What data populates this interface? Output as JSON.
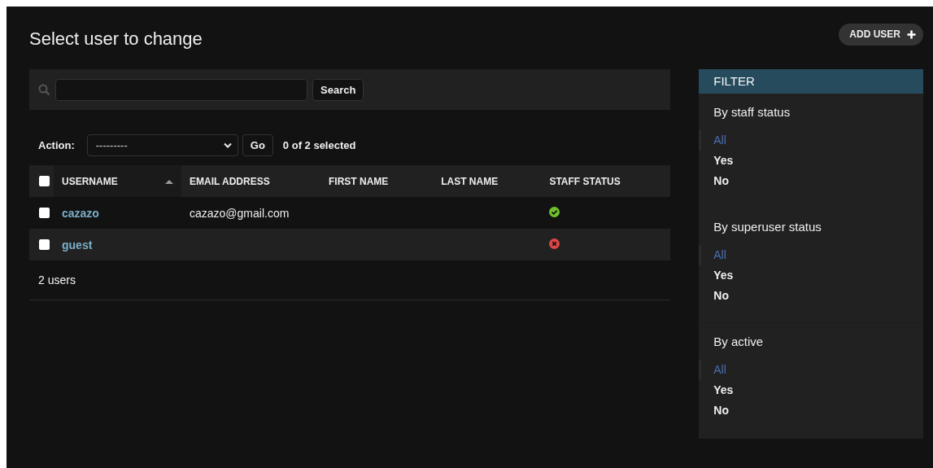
{
  "title": "Select user to change",
  "add_button": {
    "label": "ADD USER"
  },
  "search": {
    "button": "Search"
  },
  "actions": {
    "label": "Action:",
    "value": "---------",
    "go": "Go",
    "counter": "0 of 2 selected"
  },
  "table": {
    "select_all": {
      "checked": false
    },
    "columns": [
      {
        "label": "USERNAME",
        "sorted": true
      },
      {
        "label": "EMAIL ADDRESS",
        "sorted": false
      },
      {
        "label": "FIRST NAME",
        "sorted": false
      },
      {
        "label": "LAST NAME",
        "sorted": false
      },
      {
        "label": "STAFF STATUS",
        "sorted": false
      }
    ],
    "rows": [
      {
        "checked": false,
        "username": "cazazo",
        "email": "cazazo@gmail.com",
        "staff": true
      },
      {
        "checked": false,
        "username": "guest",
        "staff": false
      }
    ]
  },
  "paginator": "2 users",
  "filter": {
    "title": "FILTER",
    "groups": [
      {
        "title": "By staff status",
        "options": [
          {
            "label": "All",
            "selected": true
          },
          {
            "label": "Yes",
            "selected": false
          },
          {
            "label": "No",
            "selected": false
          }
        ]
      },
      {
        "title": "By superuser status",
        "options": [
          {
            "label": "All",
            "selected": true
          },
          {
            "label": "Yes",
            "selected": false
          },
          {
            "label": "No",
            "selected": false
          }
        ]
      },
      {
        "title": "By active",
        "options": [
          {
            "label": "All",
            "selected": true
          },
          {
            "label": "Yes",
            "selected": false
          },
          {
            "label": "No",
            "selected": false
          }
        ]
      }
    ]
  }
}
